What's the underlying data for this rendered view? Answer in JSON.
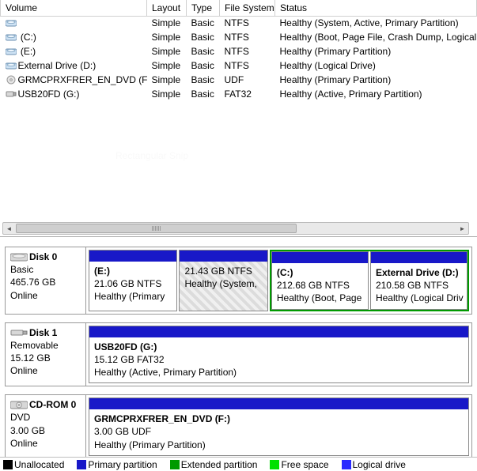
{
  "columns": {
    "volume": "Volume",
    "layout": "Layout",
    "type": "Type",
    "filesystem": "File System",
    "status": "Status"
  },
  "volumes": [
    {
      "name": "",
      "layout": "Simple",
      "type": "Basic",
      "fs": "NTFS",
      "status": "Healthy (System, Active, Primary Partition)",
      "icon": "vol-basic"
    },
    {
      "name": " (C:)",
      "layout": "Simple",
      "type": "Basic",
      "fs": "NTFS",
      "status": "Healthy (Boot, Page File, Crash Dump, Logical Dr",
      "icon": "vol-basic"
    },
    {
      "name": " (E:)",
      "layout": "Simple",
      "type": "Basic",
      "fs": "NTFS",
      "status": "Healthy (Primary Partition)",
      "icon": "vol-basic"
    },
    {
      "name": "External Drive (D:)",
      "layout": "Simple",
      "type": "Basic",
      "fs": "NTFS",
      "status": "Healthy (Logical Drive)",
      "icon": "vol-basic"
    },
    {
      "name": "GRMCPRXFRER_EN_DVD (F:)",
      "layout": "Simple",
      "type": "Basic",
      "fs": "UDF",
      "status": "Healthy (Primary Partition)",
      "icon": "vol-disc"
    },
    {
      "name": "USB20FD (G:)",
      "layout": "Simple",
      "type": "Basic",
      "fs": "FAT32",
      "status": "Healthy (Active, Primary Partition)",
      "icon": "vol-usb"
    }
  ],
  "rect_snip": "Rectangular Snip",
  "disks": [
    {
      "id": "disk0",
      "title": "Disk 0",
      "kind": "Basic",
      "size": "465.76 GB",
      "state": "Online",
      "icon": "hdd",
      "partitions": [
        {
          "label": "(E:)",
          "line2": "21.06 GB NTFS",
          "line3": "Healthy (Primary",
          "color": "#1818c8",
          "hatched": false,
          "ext": false
        },
        {
          "label": "",
          "line2": "21.43 GB NTFS",
          "line3": "Healthy (System,",
          "color": "#1818c8",
          "hatched": true,
          "ext": false
        },
        {
          "label": "(C:)",
          "line2": "212.68 GB NTFS",
          "line3": "Healthy (Boot, Page",
          "color": "#1818c8",
          "hatched": false,
          "ext": true
        },
        {
          "label": "External Drive  (D:)",
          "line2": "210.58 GB NTFS",
          "line3": "Healthy (Logical Driv",
          "color": "#1818c8",
          "hatched": false,
          "ext": true
        }
      ]
    },
    {
      "id": "disk1",
      "title": "Disk 1",
      "kind": "Removable",
      "size": "15.12 GB",
      "state": "Online",
      "icon": "usb",
      "partitions": [
        {
          "label": "USB20FD  (G:)",
          "line2": "15.12 GB FAT32",
          "line3": "Healthy (Active, Primary Partition)",
          "color": "#1818c8",
          "hatched": false,
          "ext": false
        }
      ]
    },
    {
      "id": "cdrom0",
      "title": "CD-ROM 0",
      "kind": "DVD",
      "size": "3.00 GB",
      "state": "Online",
      "icon": "disc",
      "partitions": [
        {
          "label": "GRMCPRXFRER_EN_DVD  (F:)",
          "line2": "3.00 GB UDF",
          "line3": "Healthy (Primary Partition)",
          "color": "#1818c8",
          "hatched": false,
          "ext": false
        }
      ]
    }
  ],
  "legend": {
    "unallocated": "Unallocated",
    "primary": "Primary partition",
    "extended": "Extended partition",
    "freespace": "Free space",
    "logical": "Logical drive",
    "colors": {
      "unallocated": "#000000",
      "primary": "#1818c8",
      "extended": "#009a00",
      "freespace": "#00e000",
      "logical": "#2a2aff"
    }
  }
}
